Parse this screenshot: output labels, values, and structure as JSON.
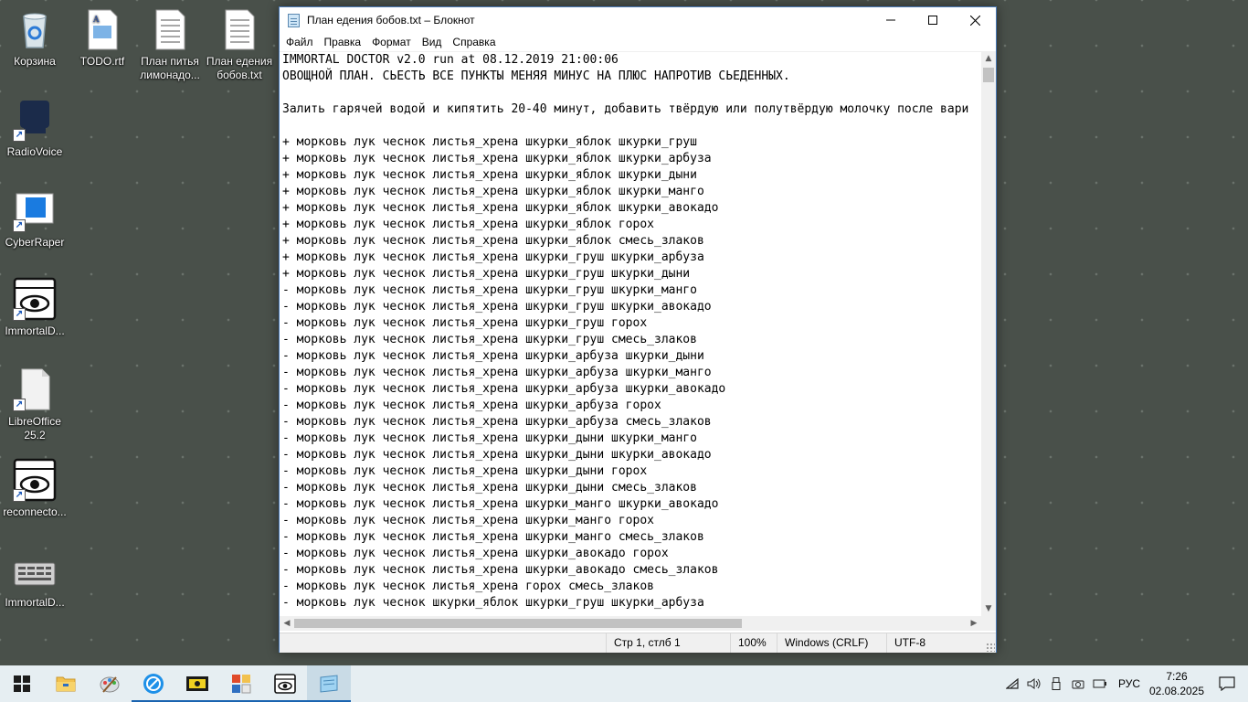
{
  "desktop": {
    "icons": [
      {
        "label": "Корзина",
        "icon": "recycle-bin-icon"
      },
      {
        "label": "TODO.rtf",
        "icon": "rtf-document-icon"
      },
      {
        "label": "План питья лимонадо...",
        "icon": "text-file-icon"
      },
      {
        "label": "План едения бобов.txt",
        "icon": "text-file-icon"
      },
      {
        "label": "RadioVoice",
        "icon": "radiovoice-app-icon"
      },
      {
        "label": "CyberRaper",
        "icon": "cyberraper-app-icon"
      },
      {
        "label": "ImmortalD...",
        "icon": "eye-app-icon"
      },
      {
        "label": "LibreOffice 25.2",
        "icon": "libreoffice-icon"
      },
      {
        "label": "reconnecto...",
        "icon": "eye-app-icon"
      },
      {
        "label": "ImmortalD...",
        "icon": "keyboard-app-icon"
      }
    ]
  },
  "notepad": {
    "title": "План едения бобов.txt – Блокнот",
    "menu": [
      "Файл",
      "Правка",
      "Формат",
      "Вид",
      "Справка"
    ],
    "lines": [
      "IMMORTAL DOCTOR v2.0 run at 08.12.2019 21:00:06",
      "ОВОЩНОЙ ПЛАН. СЬЕСТЬ ВСЕ ПУНКТЫ МЕНЯЯ МИНУС НА ПЛЮС НАПРОТИВ СЬЕДЕННЫХ.",
      "",
      "Залить гарячей водой и кипятить 20-40 минут, добавить твёрдую или полутвёрдую молочку после вари",
      "",
      "+ морковь лук чеснок листья_хрена шкурки_яблок шкурки_груш",
      "+ морковь лук чеснок листья_хрена шкурки_яблок шкурки_арбуза",
      "+ морковь лук чеснок листья_хрена шкурки_яблок шкурки_дыни",
      "+ морковь лук чеснок листья_хрена шкурки_яблок шкурки_манго",
      "+ морковь лук чеснок листья_хрена шкурки_яблок шкурки_авокадо",
      "+ морковь лук чеснок листья_хрена шкурки_яблок горох",
      "+ морковь лук чеснок листья_хрена шкурки_яблок смесь_злаков",
      "+ морковь лук чеснок листья_хрена шкурки_груш шкурки_арбуза",
      "+ морковь лук чеснок листья_хрена шкурки_груш шкурки_дыни",
      "- морковь лук чеснок листья_хрена шкурки_груш шкурки_манго",
      "- морковь лук чеснок листья_хрена шкурки_груш шкурки_авокадо",
      "- морковь лук чеснок листья_хрена шкурки_груш горох",
      "- морковь лук чеснок листья_хрена шкурки_груш смесь_злаков",
      "- морковь лук чеснок листья_хрена шкурки_арбуза шкурки_дыни",
      "- морковь лук чеснок листья_хрена шкурки_арбуза шкурки_манго",
      "- морковь лук чеснок листья_хрена шкурки_арбуза шкурки_авокадо",
      "- морковь лук чеснок листья_хрена шкурки_арбуза горох",
      "- морковь лук чеснок листья_хрена шкурки_арбуза смесь_злаков",
      "- морковь лук чеснок листья_хрена шкурки_дыни шкурки_манго",
      "- морковь лук чеснок листья_хрена шкурки_дыни шкурки_авокадо",
      "- морковь лук чеснок листья_хрена шкурки_дыни горох",
      "- морковь лук чеснок листья_хрена шкурки_дыни смесь_злаков",
      "- морковь лук чеснок листья_хрена шкурки_манго шкурки_авокадо",
      "- морковь лук чеснок листья_хрена шкурки_манго горох",
      "- морковь лук чеснок листья_хрена шкурки_манго смесь_злаков",
      "- морковь лук чеснок листья_хрена шкурки_авокадо горох",
      "- морковь лук чеснок листья_хрена шкурки_авокадо смесь_злаков",
      "- морковь лук чеснок листья_хрена горох смесь_злаков",
      "- морковь лук чеснок шкурки_яблок шкурки_груш шкурки_арбуза"
    ],
    "status": {
      "position": "Стр 1, стлб 1",
      "zoom": "100%",
      "line_endings": "Windows (CRLF)",
      "encoding": "UTF-8"
    }
  },
  "taskbar": {
    "apps": [
      {
        "icon": "windows-start-icon",
        "running": false,
        "active": false
      },
      {
        "icon": "file-explorer-icon",
        "running": false,
        "active": false
      },
      {
        "icon": "paint-palette-icon",
        "running": false,
        "active": false
      },
      {
        "icon": "radio-globe-icon",
        "running": true,
        "active": false
      },
      {
        "icon": "yellow-app-icon",
        "running": true,
        "active": false
      },
      {
        "icon": "colorful-windows-icon",
        "running": true,
        "active": false
      },
      {
        "icon": "eye-app-icon",
        "running": true,
        "active": false
      },
      {
        "icon": "notepad-icon",
        "running": true,
        "active": true
      }
    ],
    "tray": {
      "language": "РУС",
      "time": "7:26",
      "date": "02.08.2025"
    }
  },
  "colors": {
    "desktop_bg": "#49504a",
    "taskbar_bg": "#e6eef2",
    "accent": "#1a64b0"
  }
}
